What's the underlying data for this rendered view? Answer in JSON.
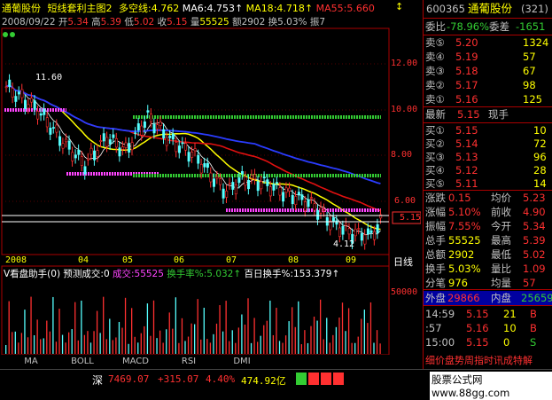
{
  "header": {
    "stock_name": "通葡股份",
    "indicator": "短线套利主图2",
    "bull_label": "多空线",
    "bull_value": "4.762",
    "ma6_label": "MA6",
    "ma6_value": "4.753",
    "ma18_label": "MA18",
    "ma18_value": "4.718",
    "ma55_label": "MA55",
    "ma55_value": "5.660",
    "date": "2008/09/22",
    "open_label": "开",
    "open": "5.34",
    "high_label": "高",
    "high": "5.39",
    "low_label": "低",
    "low": "5.02",
    "close_label": "收",
    "close": "5.15",
    "volume_label": "量",
    "volume": "55525",
    "amount_label": "额",
    "amount": "2902",
    "turnover_label": "换",
    "turnover": "5.03%",
    "amp_label": "振7"
  },
  "main_chart": {
    "y_ticks": [
      "12.00",
      "10.00",
      "8.00",
      "6.00"
    ],
    "price_tag": "5.15",
    "high_annot": "11.60",
    "low_annot": "4.12",
    "x_ticks": [
      "2008",
      "04",
      "05",
      "06",
      "07",
      "08",
      "09"
    ],
    "period": "日线"
  },
  "sub_chart": {
    "title": "V看盘助手(0)",
    "predict": "预测成交:0",
    "volume_label": "成交",
    "volume_value": "55525",
    "turnover_label": "换手率%",
    "turnover_value": "5.032",
    "daily_label": "百日换手%",
    "daily_value": "153.379",
    "y_ticks": [
      "50000"
    ]
  },
  "tabs": [
    "MA",
    "BOLL",
    "MACD",
    "RSI",
    "DMI"
  ],
  "quote": {
    "code": "600365",
    "name": "通葡股份",
    "num": "(321)",
    "ratio_label": "委比",
    "ratio": "-78.96%",
    "diff_label": "委差",
    "diff": "-1651",
    "sells": [
      {
        "label": "卖⑤",
        "price": "5.20",
        "vol": "1324"
      },
      {
        "label": "卖④",
        "price": "5.19",
        "vol": "57"
      },
      {
        "label": "卖③",
        "price": "5.18",
        "vol": "67"
      },
      {
        "label": "卖②",
        "price": "5.17",
        "vol": "98"
      },
      {
        "label": "卖①",
        "price": "5.16",
        "vol": "125"
      }
    ],
    "latest_label": "最新",
    "latest": "5.15",
    "current_label": "现手",
    "buys": [
      {
        "label": "买①",
        "price": "5.15",
        "vol": "10"
      },
      {
        "label": "买②",
        "price": "5.14",
        "vol": "72"
      },
      {
        "label": "买③",
        "price": "5.13",
        "vol": "96"
      },
      {
        "label": "买④",
        "price": "5.12",
        "vol": "28"
      },
      {
        "label": "买⑤",
        "price": "5.11",
        "vol": "14"
      }
    ],
    "stats": [
      {
        "l1": "涨跌",
        "v1": "0.15",
        "l2": "均价",
        "v2": "5.23"
      },
      {
        "l1": "涨幅",
        "v1": "5.10%",
        "l2": "前收",
        "v2": "4.90"
      },
      {
        "l1": "振幅",
        "v1": "7.55%",
        "l2": "今开",
        "v2": "5.34"
      },
      {
        "l1": "总手",
        "v1": "55525",
        "l2": "最高",
        "v2": "5.39"
      },
      {
        "l1": "总额",
        "v1": "2902",
        "l2": "最低",
        "v2": "5.02"
      },
      {
        "l1": "换手",
        "v1": "5.03%",
        "l2": "量比",
        "v2": "1.09"
      },
      {
        "l1": "分笔",
        "v1": "976",
        "l2": "均量",
        "v2": "57"
      }
    ],
    "outer_label": "外盘",
    "outer": "29866",
    "inner_label": "内盘",
    "inner": "25659",
    "ticks": [
      {
        "time": "14:59",
        "price": "5.15",
        "vol": "21",
        "side": "B"
      },
      {
        "time": ":57",
        "price": "5.16",
        "vol": "10",
        "side": "B"
      },
      {
        "time": "15:00",
        "price": "5.15",
        "vol": "0",
        "side": "S"
      }
    ],
    "banner": "细价盘势周指时讯成特解"
  },
  "status": {
    "market": "深",
    "index": "7469.07",
    "change": "+315.07",
    "pct": "4.40%",
    "amount": "474.92亿",
    "site": "股票公式网www.88gg.com"
  },
  "colors": {
    "red": "#ff3030",
    "green": "#33cc33",
    "yellow": "#ffff00",
    "ma_blue": "#2a3cff",
    "ma_red": "#e01010",
    "magenta": "#ff44ff",
    "cyan": "#55ffff"
  }
}
